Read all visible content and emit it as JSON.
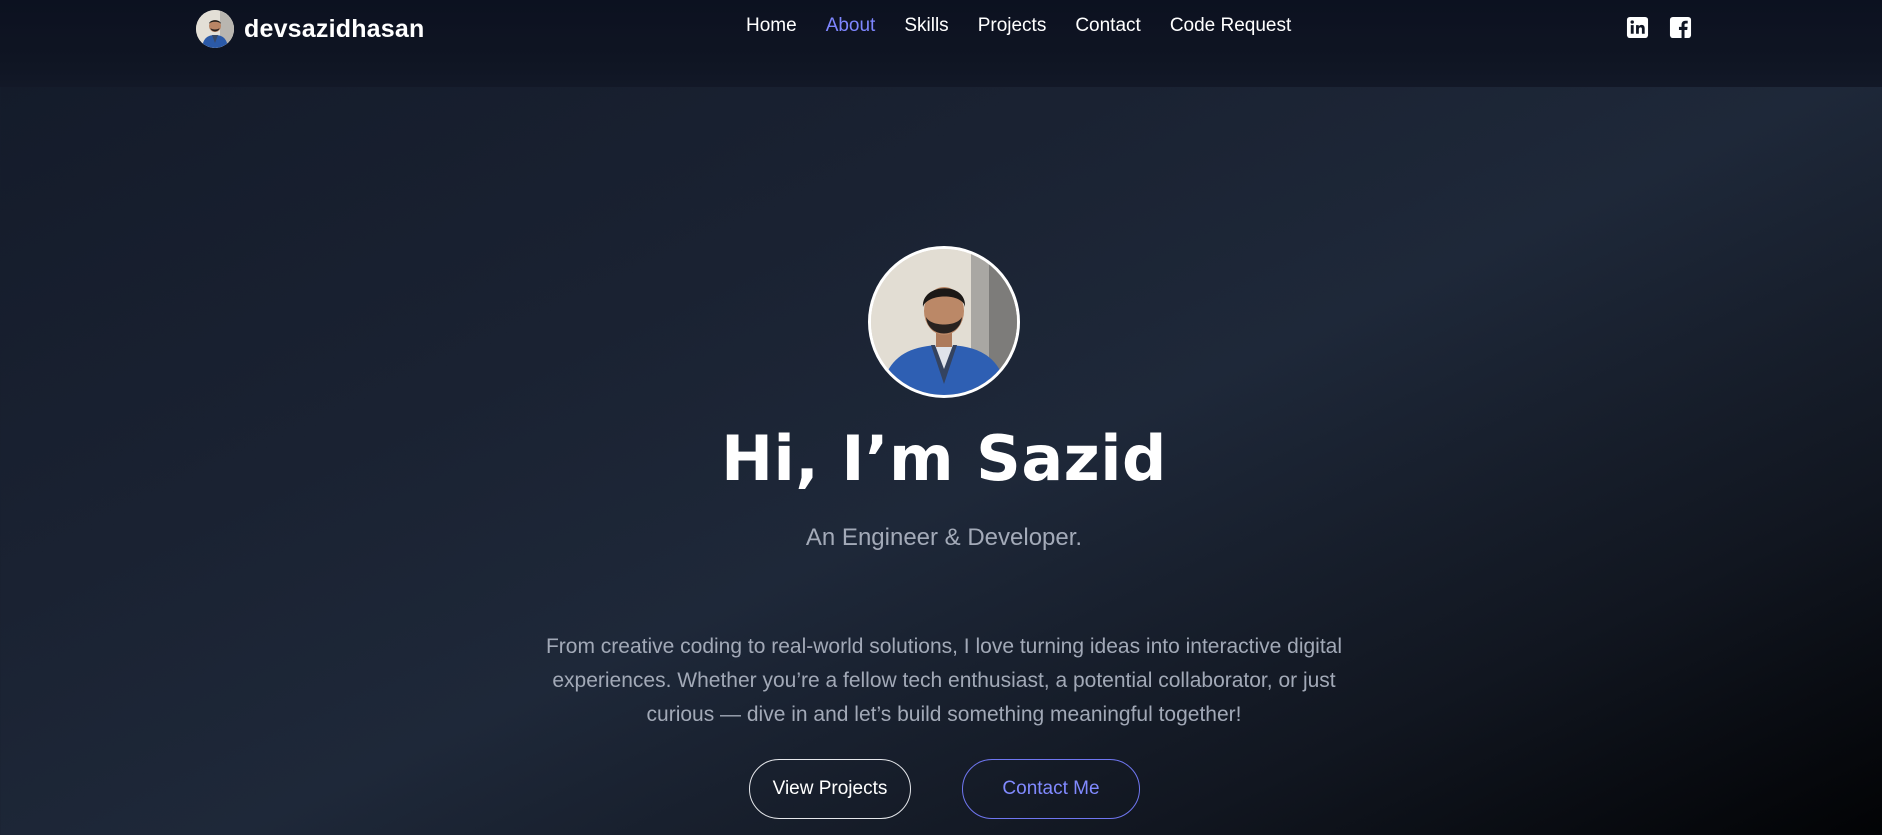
{
  "brand": {
    "name": "devsazidhasan",
    "avatar_icon": "profile-photo-icon"
  },
  "nav": {
    "items": [
      {
        "label": "Home",
        "active": false
      },
      {
        "label": "About",
        "active": true
      },
      {
        "label": "Skills",
        "active": false
      },
      {
        "label": "Projects",
        "active": false
      },
      {
        "label": "Contact",
        "active": false
      },
      {
        "label": "Code Request",
        "active": false
      }
    ],
    "active_color": "#7e86ff"
  },
  "social": {
    "icons": [
      "linkedin-icon",
      "facebook-icon"
    ]
  },
  "hero": {
    "avatar_icon": "profile-photo-icon",
    "title": "Hi, I’m Sazid",
    "subtitle": "An Engineer & Developer.",
    "description": "From creative coding to real-world solutions, I love turning ideas into interactive digital experiences. Whether you’re a fellow tech enthusiast, a potential collaborator, or just curious — dive in and let’s build something meaningful together!",
    "primary_button": "View Projects",
    "secondary_button": "Contact Me"
  },
  "colors": {
    "accent": "#7e86ff",
    "background": "#1a2232"
  }
}
